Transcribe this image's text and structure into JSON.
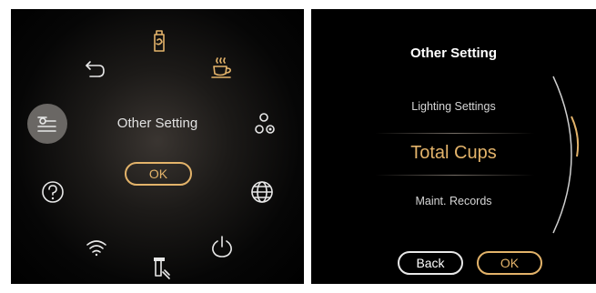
{
  "left_menu": {
    "center_title": "Other Setting",
    "ok_label": "OK",
    "icons": [
      "bottle-icon",
      "coffee-cup-icon",
      "share-nodes-icon",
      "globe-icon",
      "power-icon",
      "cleaning-icon",
      "wifi-icon",
      "help-icon",
      "settings-sliders-icon",
      "back-arrow-icon"
    ],
    "selected_icon": "settings-sliders-icon"
  },
  "right_menu": {
    "title": "Other Setting",
    "items": [
      "Lighting Settings",
      "Total Cups",
      "Maint. Records"
    ],
    "active_item": "Total Cups",
    "back_label": "Back",
    "ok_label": "OK"
  },
  "colors": {
    "accent": "#e3b36a",
    "background": "#000000",
    "selected_bg": "#6a6764",
    "text": "#e8e8e8"
  }
}
